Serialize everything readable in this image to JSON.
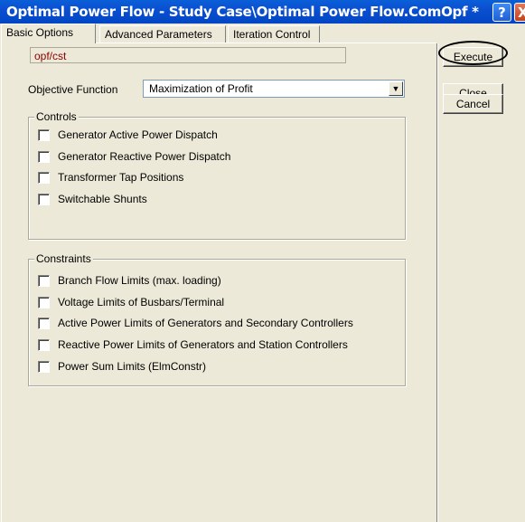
{
  "window": {
    "title": "Optimal Power Flow - Study Case\\Optimal Power Flow.ComOpf *",
    "help_label": "?",
    "close_label": "X"
  },
  "tabs": [
    {
      "label": "Basic Options",
      "active": true
    },
    {
      "label": "Advanced Parameters",
      "active": false
    },
    {
      "label": "Iteration Control",
      "active": false
    }
  ],
  "main": {
    "path_value": "opf/cst",
    "objective_label": "Objective Function",
    "objective_value": "Maximization of Profit",
    "controls": {
      "title": "Controls",
      "items": [
        {
          "label": "Generator Active Power Dispatch",
          "checked": false
        },
        {
          "label": "Generator Reactive Power Dispatch",
          "checked": false
        },
        {
          "label": "Transformer Tap Positions",
          "checked": false
        },
        {
          "label": "Switchable Shunts",
          "checked": false
        }
      ]
    },
    "constraints": {
      "title": "Constraints",
      "items": [
        {
          "label": "Branch Flow Limits (max. loading)",
          "checked": false
        },
        {
          "label": "Voltage Limits of Busbars/Terminal",
          "checked": false
        },
        {
          "label": "Active Power Limits of Generators and Secondary Controllers",
          "checked": false
        },
        {
          "label": "Reactive Power Limits of Generators and Station Controllers",
          "checked": false
        },
        {
          "label": "Power Sum Limits (ElmConstr)",
          "checked": false
        }
      ]
    }
  },
  "sidebar": {
    "execute_label": "Execute",
    "close_label": "Close",
    "cancel_label": "Cancel"
  },
  "colors": {
    "titlebar": "#0a4fd0",
    "dialog_bg": "#ece9d8",
    "path_text": "#8b0000"
  }
}
